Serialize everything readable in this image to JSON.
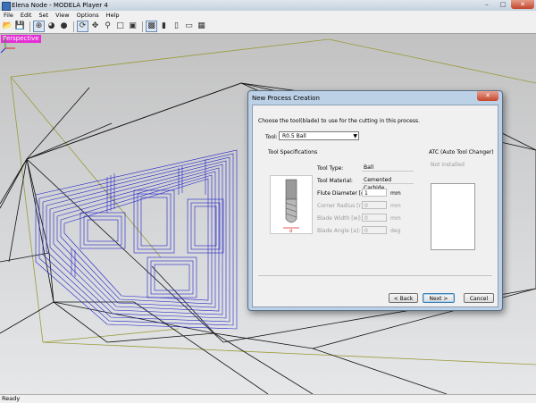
{
  "window": {
    "title": "Elena Node - MODELA Player 4",
    "min": "–",
    "max": "□",
    "close": "✕"
  },
  "menu": [
    "File",
    "Edit",
    "Set",
    "View",
    "Options",
    "Help"
  ],
  "viewport": {
    "label": "Perspective"
  },
  "status": {
    "text": "Ready"
  },
  "dialog": {
    "title": "New Process Creation",
    "close": "✕",
    "prompt": "Choose the tool(blade) to use for the cutting in this process.",
    "tool_label": "Tool:",
    "tool_value": "R0.5 Ball",
    "specs_heading": "Tool Specifications",
    "specs": {
      "type_label": "Tool Type:",
      "type_value": "Ball",
      "material_label": "Tool Material:",
      "material_value": "Cemented Carbide",
      "flute_label": "Flute Diameter [d]:",
      "flute_value": "1",
      "flute_unit": "mm",
      "corner_label": "Corner Radius [r]:",
      "corner_value": "0",
      "corner_unit": "mm",
      "width_label": "Blade Width [w]:",
      "width_value": "0",
      "width_unit": "mm",
      "angle_label": "Blade Angle [a]:",
      "angle_value": "0",
      "angle_unit": "deg"
    },
    "atc_heading": "ATC (Auto Tool Changer)",
    "atc_status": "Not installed",
    "buttons": {
      "back": "< Back",
      "next": "Next >",
      "cancel": "Cancel"
    }
  }
}
